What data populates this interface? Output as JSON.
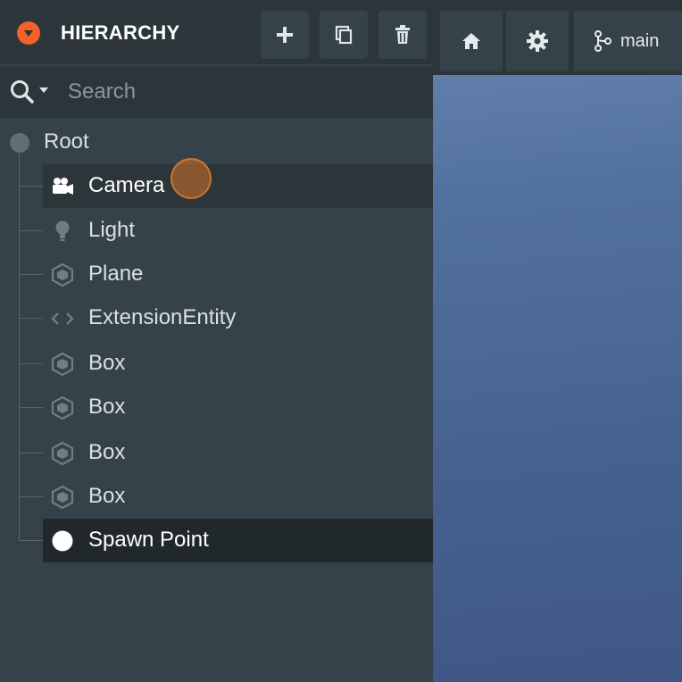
{
  "panel": {
    "title": "HIERARCHY",
    "buttons": [
      {
        "icon": "plus-icon",
        "tooltip": "Add"
      },
      {
        "icon": "duplicate-icon",
        "tooltip": "Duplicate"
      },
      {
        "icon": "trash-icon",
        "tooltip": "Delete"
      }
    ],
    "search": {
      "placeholder": "Search",
      "value": ""
    }
  },
  "tree": {
    "root": {
      "label": "Root"
    },
    "items": [
      {
        "label": "Camera",
        "icon": "camera-icon",
        "selected": true
      },
      {
        "label": "Light",
        "icon": "lightbulb-icon",
        "selected": false
      },
      {
        "label": "Plane",
        "icon": "hexagon-icon",
        "selected": false
      },
      {
        "label": "ExtensionEntity",
        "icon": "code-icon",
        "selected": false
      },
      {
        "label": "Box",
        "icon": "hexagon-icon",
        "selected": false
      },
      {
        "label": "Box",
        "icon": "hexagon-icon",
        "selected": false
      },
      {
        "label": "Box",
        "icon": "hexagon-icon",
        "selected": false
      },
      {
        "label": "Box",
        "icon": "hexagon-icon",
        "selected": false
      },
      {
        "label": "Spawn Point",
        "icon": "spawn-point-icon",
        "selected": true
      }
    ]
  },
  "viewport": {
    "toolbar": [
      {
        "icon": "home-icon"
      },
      {
        "icon": "gear-icon"
      },
      {
        "icon": "branch-icon",
        "label": "main"
      }
    ]
  },
  "colors": {
    "accent": "#f2612b",
    "panel_bg": "#364249",
    "header_bg": "#2c3539",
    "selected_row_bg": "#2c3539",
    "spawn_row_bg": "#20282c",
    "viewport_top": "#6885b2",
    "viewport_bottom": "#3f5786"
  }
}
